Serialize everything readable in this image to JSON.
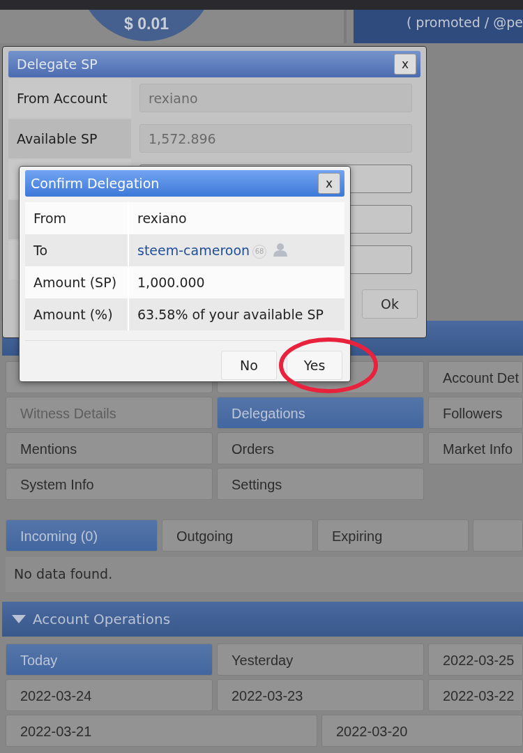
{
  "header": {
    "balance_badge": "$ 0.01",
    "promo_text": "( promoted / @pe"
  },
  "menu": [
    {
      "selected": false
    },
    {
      "selected": false
    },
    {
      "label": "Account Det",
      "disabled": false,
      "selected": false
    },
    {
      "label": "Witness Details",
      "disabled": true,
      "selected": false
    },
    {
      "label": "Delegations",
      "disabled": false,
      "selected": true
    },
    {
      "label": "Followers",
      "disabled": false,
      "selected": false
    },
    {
      "label": "Mentions",
      "disabled": false,
      "selected": false
    },
    {
      "label": "Orders",
      "disabled": false,
      "selected": false
    },
    {
      "label": "Market Info",
      "disabled": false,
      "selected": false
    },
    {
      "label": "System Info",
      "disabled": false,
      "selected": false
    },
    {
      "label": "Settings",
      "disabled": false,
      "selected": false
    }
  ],
  "delegation_tabs": [
    {
      "label": "Incoming (0)",
      "selected": true
    },
    {
      "label": "Outgoing",
      "selected": false
    },
    {
      "label": "Expiring",
      "selected": false
    },
    {
      "selected": false
    }
  ],
  "empty_message": "No data found.",
  "operations": {
    "title": "Account Operations",
    "expanded": true,
    "days": [
      {
        "label": "Today",
        "selected": true
      },
      {
        "label": "Yesterday",
        "selected": false
      },
      {
        "label": "2022-03-25",
        "selected": false
      },
      {
        "label": "2022-03-24",
        "selected": false
      },
      {
        "label": "2022-03-23",
        "selected": false
      },
      {
        "label": "2022-03-22",
        "selected": false
      },
      {
        "label": "2022-03-21",
        "selected": false
      },
      {
        "label": "2022-03-20",
        "selected": false
      }
    ]
  },
  "delegate_dialog": {
    "title": "Delegate SP",
    "close": "x",
    "fields": [
      {
        "label": "From Account",
        "value": "rexiano",
        "disabled": true
      },
      {
        "label": "Available SP",
        "value": "1,572.896",
        "disabled": true
      },
      {
        "disabled": false
      },
      {
        "disabled": false
      },
      {
        "disabled": false
      }
    ],
    "ok_button": "Ok"
  },
  "confirm_dialog": {
    "title": "Confirm Delegation",
    "close": "x",
    "rows": [
      {
        "label": "From",
        "value": "rexiano",
        "kind": "text"
      },
      {
        "label": "To",
        "value": "steem-cameroon",
        "kind": "account",
        "reputation": "68"
      },
      {
        "label": "Amount (SP)",
        "value": "1,000.000",
        "kind": "text"
      },
      {
        "label": "Amount (%)",
        "value": "63.58% of your available SP",
        "kind": "text"
      }
    ],
    "buttons": [
      {
        "label": "No"
      },
      {
        "label": "Yes",
        "highlighted": true
      }
    ]
  }
}
